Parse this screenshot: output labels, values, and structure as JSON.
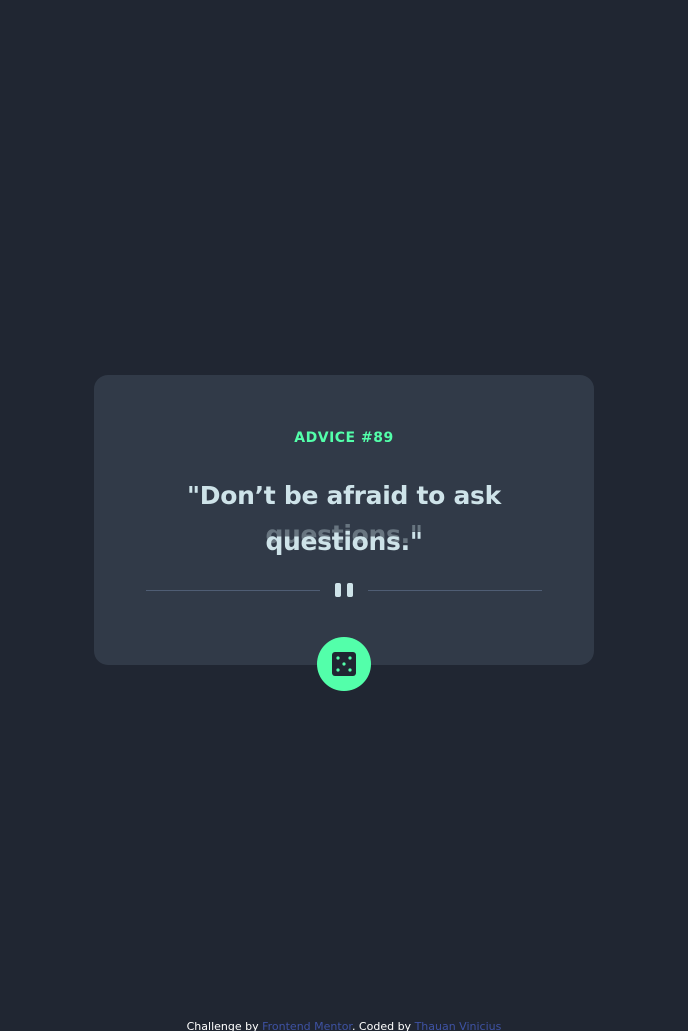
{
  "card": {
    "advice_label": "ADVICE #89",
    "quote_line1": "\"Don’t be afraid to ask",
    "quote_line2": "questions.\""
  },
  "dice_button": {
    "icon": "dice-icon"
  },
  "divider": {
    "icon": "pause-icon"
  },
  "footer": {
    "challenge_text": "Challenge by",
    "frontend_mentor_link": "Frontend Mentor",
    "coded_by_text": ". Coded by",
    "author_link": "Thauan Vinicius"
  },
  "colors": {
    "background": "#202632",
    "card": "#313a48",
    "accent": "#53ffaa",
    "text": "#cee3e9",
    "link": "#3e52a3"
  }
}
